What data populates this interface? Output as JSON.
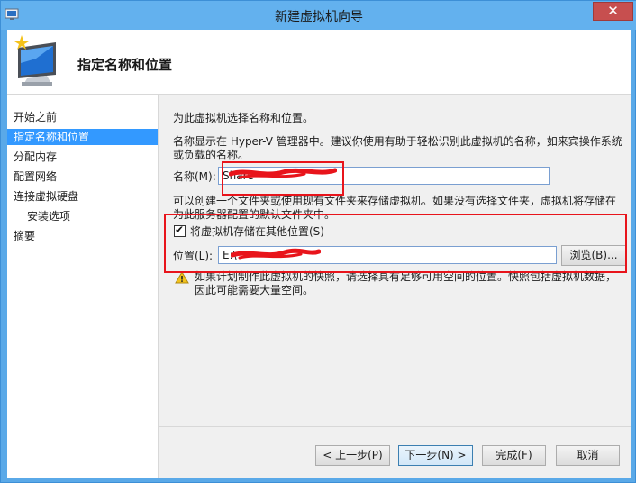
{
  "window": {
    "title": "新建虚拟机向导",
    "close_glyph": "✕"
  },
  "header": {
    "title": "指定名称和位置"
  },
  "nav": {
    "items": [
      {
        "label": "开始之前",
        "active": false
      },
      {
        "label": "指定名称和位置",
        "active": true
      },
      {
        "label": "分配内存",
        "active": false
      },
      {
        "label": "配置网络",
        "active": false
      },
      {
        "label": "连接虚拟硬盘",
        "active": false
      },
      {
        "label": "安装选项",
        "active": false,
        "sub": true
      },
      {
        "label": "摘要",
        "active": false
      }
    ]
  },
  "content": {
    "intro": "为此虚拟机选择名称和位置。",
    "name_desc_line1": "名称显示在 Hyper-V 管理器中。建议你使用有助于轻松识别此虚拟机的名称，如来宾操作系统",
    "name_desc_line2": "或负载的名称。",
    "name_label": "名称(M):",
    "name_value": "Share",
    "folder_desc_line1": "可以创建一个文件夹或使用现有文件夹来存储虚拟机。如果没有选择文件夹，虚拟机将存储在",
    "folder_desc_line2": "为此服务器配置的默认文件夹中。",
    "checkbox_label": "将虚拟机存储在其他位置(S)",
    "checkbox_checked": true,
    "location_label": "位置(L):",
    "location_value": "E:\\",
    "browse_label": "浏览(B)...",
    "warning_line1": "如果计划制作此虚拟机的快照，请选择具有足够可用空间的位置。快照包括虚拟机数据，",
    "warning_line2": "因此可能需要大量空间。"
  },
  "footer": {
    "prev_label": "< 上一步(P)",
    "next_label": "下一步(N) >",
    "finish_label": "完成(F)",
    "cancel_label": "取消"
  },
  "colors": {
    "accent": "#3399ff",
    "titlebar": "#63b1ee",
    "close": "#c74f4f",
    "annotation": "#e8141b"
  },
  "icons": {
    "window": "hyperv-window-icon",
    "header": "monitor-sparkle-icon",
    "warning": "warning-triangle-icon"
  }
}
